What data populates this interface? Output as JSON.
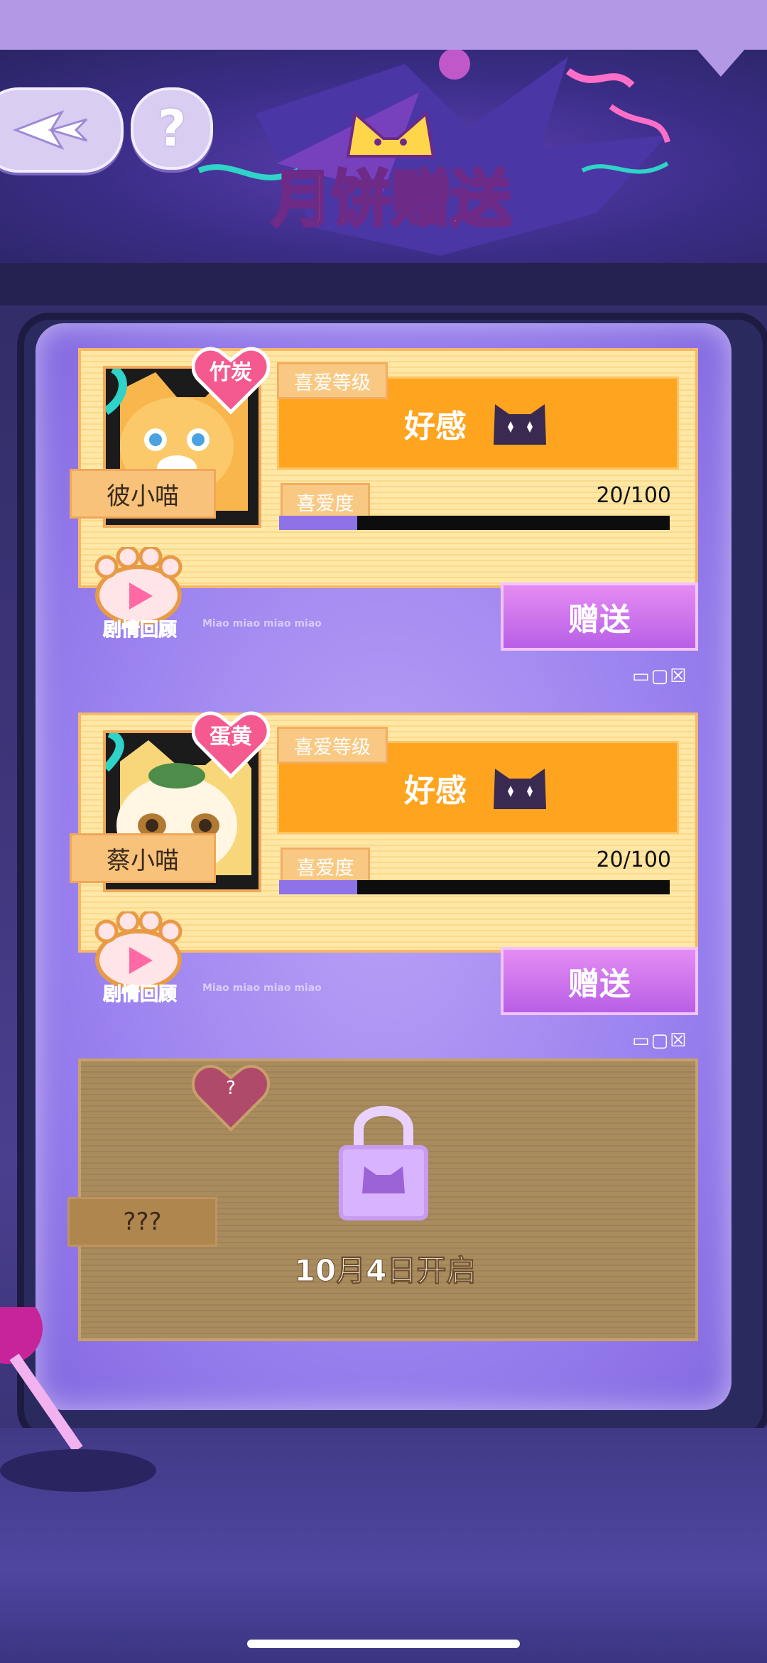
{
  "header": {
    "title": "月饼赠送"
  },
  "cards": [
    {
      "heart_name": "竹炭",
      "cat_name": "彼小喵",
      "level_label": "喜爱等级",
      "level_value": "好感",
      "affection_label": "喜爱度",
      "affection_value": "20/100",
      "affection_progress": 0.2,
      "review_label": "剧情回顾",
      "gift_label": "赠送",
      "footer_text": "Miao miao miao miao"
    },
    {
      "heart_name": "蛋黄",
      "cat_name": "蔡小喵",
      "level_label": "喜爱等级",
      "level_value": "好感",
      "affection_label": "喜爱度",
      "affection_value": "20/100",
      "affection_progress": 0.2,
      "review_label": "剧情回顾",
      "gift_label": "赠送",
      "footer_text": "Miao miao miao miao"
    }
  ],
  "locked_card": {
    "heart_name": "?",
    "cat_name": "???",
    "unlock_text": "10月4日开启"
  },
  "colors": {
    "accent_orange": "#ffa41e",
    "gift_purple": "#c46be9",
    "screen_purple": "#9a81ef"
  }
}
